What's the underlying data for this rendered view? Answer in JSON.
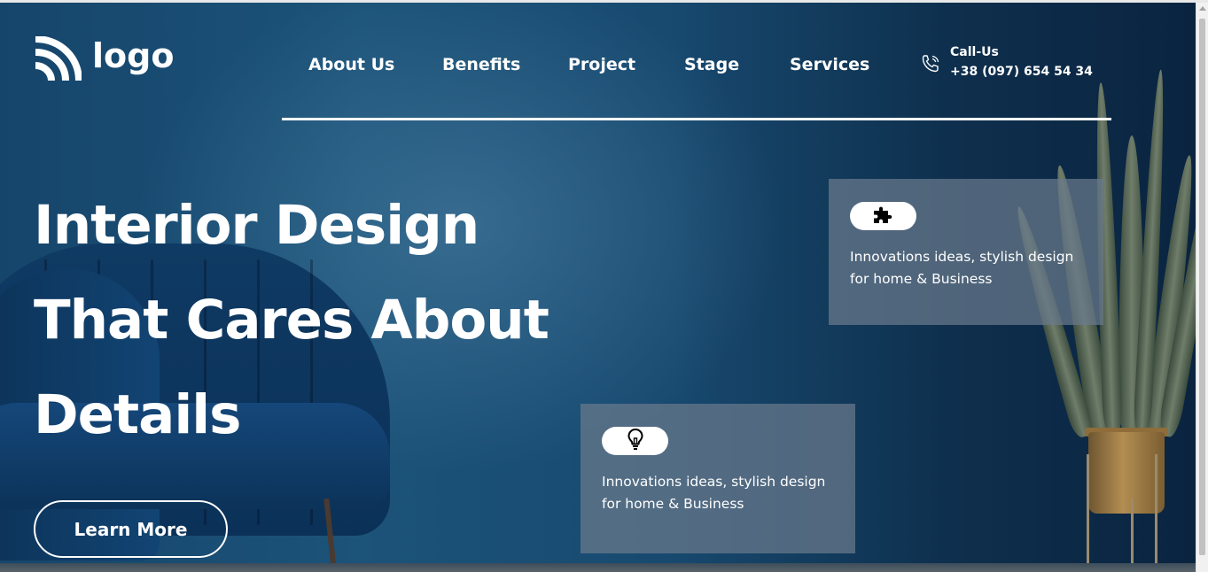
{
  "logo": {
    "text": "logo",
    "icon": "wifi-arcs-logo-icon"
  },
  "nav": {
    "items": [
      {
        "label": "About Us"
      },
      {
        "label": "Benefits"
      },
      {
        "label": "Project"
      },
      {
        "label": "Stage"
      },
      {
        "label": "Services"
      }
    ]
  },
  "call": {
    "icon": "phone-icon",
    "label": "Call-Us",
    "number": "+38 (097) 654 54 34"
  },
  "hero": {
    "headline": [
      "Interior Design",
      "That Cares About",
      "Details"
    ],
    "cta_label": "Learn More"
  },
  "cards": [
    {
      "icon": "puzzle-icon",
      "text_line1": "Innovations ideas, stylish design",
      "text_line2": "for home & Business"
    },
    {
      "icon": "lightbulb-icon",
      "text_line1": "Innovations ideas, stylish design",
      "text_line2": "for home & Business"
    }
  ],
  "colors": {
    "hero_bg": "#184a70",
    "text": "#ffffff",
    "card_bg": "#697a8c"
  }
}
